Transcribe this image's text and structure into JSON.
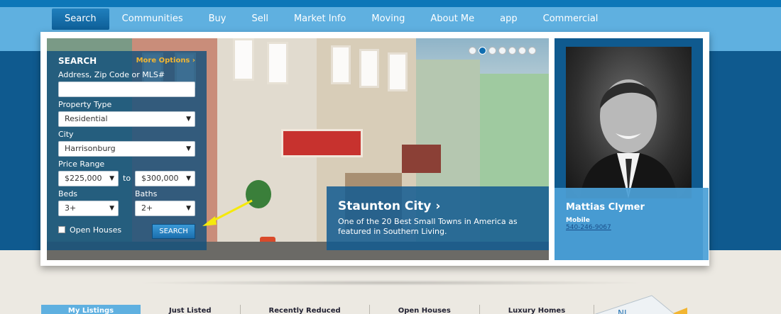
{
  "nav": {
    "items": [
      "Search",
      "Communities",
      "Buy",
      "Sell",
      "Market Info",
      "Moving",
      "About Me",
      "app",
      "Commercial"
    ],
    "active_index": 0
  },
  "search": {
    "title": "SEARCH",
    "more_options": "More Options",
    "address_label": "Address, Zip Code or MLS#",
    "address_value": "",
    "property_type_label": "Property Type",
    "property_type_value": "Residential",
    "city_label": "City",
    "city_value": "Harrisonburg",
    "price_range_label": "Price Range",
    "price_min": "$225,000",
    "price_to": "to",
    "price_max": "$300,000",
    "beds_label": "Beds",
    "beds_value": "3+",
    "baths_label": "Baths",
    "baths_value": "2+",
    "open_houses_label": "Open Houses",
    "search_button": "SEARCH"
  },
  "slider": {
    "total": 7,
    "active_index": 1
  },
  "caption": {
    "title": "Staunton City",
    "text": "One of the 20 Best Small Towns in America as featured in Southern Living."
  },
  "agent": {
    "name": "Mattias Clymer",
    "role": "Mobile",
    "phone": "540-246-9067"
  },
  "bottom_tabs": [
    "My Listings",
    "Just Listed",
    "Recently Reduced",
    "Open Houses",
    "Luxury Homes"
  ],
  "colors": {
    "accent_blue": "#0f5a8f",
    "light_blue": "#5fb0e0",
    "more_options": "#f2b531"
  }
}
